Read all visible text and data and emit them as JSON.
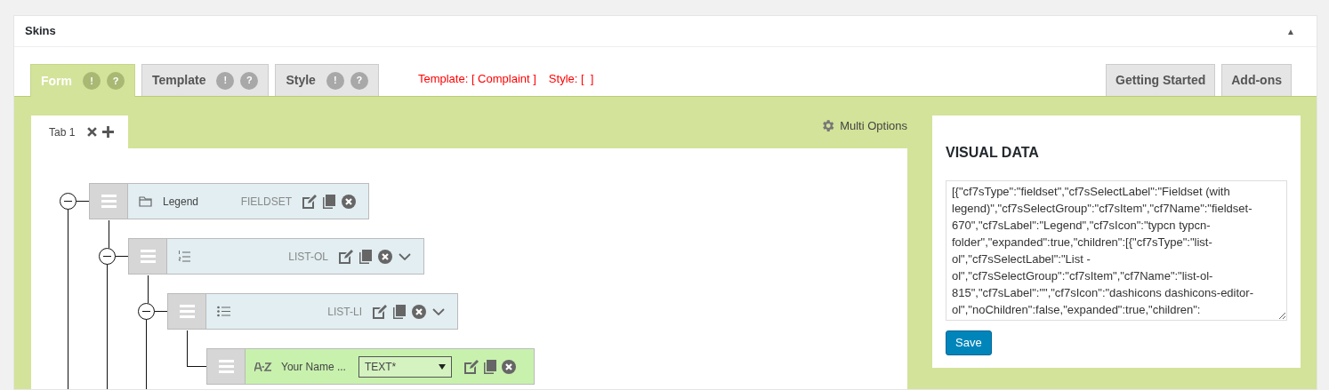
{
  "panel": {
    "title": "Skins",
    "toggle": "▲"
  },
  "tabs": [
    {
      "label": "Form",
      "selected": true,
      "badges": [
        "!",
        "?"
      ]
    },
    {
      "label": "Template",
      "selected": false,
      "badges": [
        "!",
        "?"
      ]
    },
    {
      "label": "Style",
      "selected": false,
      "badges": [
        "!",
        "?"
      ]
    }
  ],
  "status": {
    "template_label": "Template: [ Complaint ]",
    "style_label": "Style: [  ]"
  },
  "right_tabs": [
    {
      "label": "Getting Started"
    },
    {
      "label": "Add-ons"
    }
  ],
  "form_tabs": [
    {
      "label": "Tab 1",
      "selected": true
    }
  ],
  "multi_options": "Multi Options",
  "tree": [
    {
      "kind": "fieldset",
      "label": "Legend",
      "type": "FIELDSET",
      "expanded": true,
      "children": [
        {
          "kind": "list-ol",
          "type": "LIST-OL",
          "expanded": true,
          "children": [
            {
              "kind": "list-li",
              "type": "LIST-LI",
              "expanded": true,
              "children": [
                {
                  "kind": "text",
                  "label": "Your Name ...",
                  "type": "TEXT*"
                }
              ]
            }
          ]
        }
      ]
    }
  ],
  "visual_data": {
    "title": "VISUAL DATA",
    "value": "[{\"cf7sType\":\"fieldset\",\"cf7sSelectLabel\":\"Fieldset (with legend)\",\"cf7sSelectGroup\":\"cf7sItem\",\"cf7Name\":\"fieldset-670\",\"cf7sLabel\":\"Legend\",\"cf7sIcon\":\"typcn typcn-folder\",\"expanded\":true,\"children\":[{\"cf7sType\":\"list-ol\",\"cf7sSelectLabel\":\"List - ol\",\"cf7sSelectGroup\":\"cf7sItem\",\"cf7Name\":\"list-ol-815\",\"cf7sLabel\":\"\",\"cf7sIcon\":\"dashicons dashicons-editor-ol\",\"noChildren\":false,\"expanded\":true,\"children\":",
    "save": "Save"
  }
}
